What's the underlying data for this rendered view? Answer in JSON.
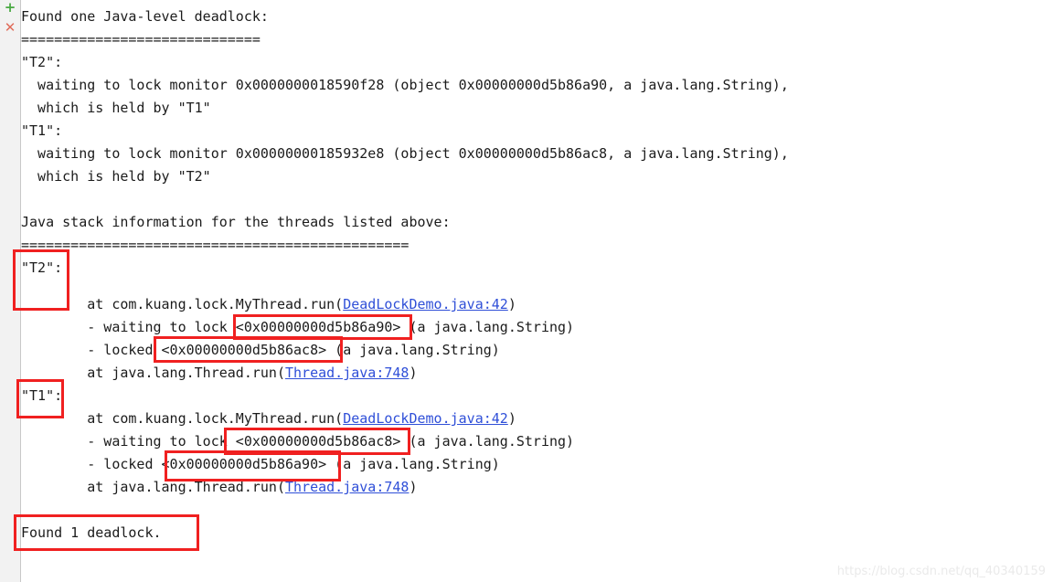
{
  "gutter": {
    "add_icon": "+",
    "close_icon": "✕"
  },
  "console": {
    "lines": [
      {
        "id": "l1",
        "text": "Found one Java-level deadlock:"
      },
      {
        "id": "l2",
        "text": "============================="
      },
      {
        "id": "l3",
        "text": "\"T2\":"
      },
      {
        "id": "l4",
        "text": "  waiting to lock monitor 0x0000000018590f28 (object 0x00000000d5b86a90, a java.lang.String),"
      },
      {
        "id": "l5",
        "text": "  which is held by \"T1\""
      },
      {
        "id": "l6",
        "text": "\"T1\":"
      },
      {
        "id": "l7",
        "text": "  waiting to lock monitor 0x00000000185932e8 (object 0x00000000d5b86ac8, a java.lang.String),"
      },
      {
        "id": "l8",
        "text": "  which is held by \"T2\""
      },
      {
        "id": "l9",
        "text": ""
      },
      {
        "id": "l10",
        "text": "Java stack information for the threads listed above:"
      },
      {
        "id": "l11",
        "text": "==============================================="
      },
      {
        "id": "l12",
        "text": "\"T2\":"
      }
    ],
    "t2_stack": {
      "at_mythread_prefix": "        at com.kuang.lock.MyThread.run(",
      "at_mythread_link": "DeadLockDemo.java:42",
      "at_mythread_suffix": ")",
      "waiting": "        - waiting to lock <0x00000000d5b86a90> (a java.lang.String)",
      "locked": "        - locked <0x00000000d5b86ac8> (a java.lang.String)",
      "at_thread_prefix": "        at java.lang.Thread.run(",
      "at_thread_link": "Thread.java:748",
      "at_thread_suffix": ")"
    },
    "t1_label": "\"T1\":",
    "t1_stack": {
      "at_mythread_prefix": "        at com.kuang.lock.MyThread.run(",
      "at_mythread_link": "DeadLockDemo.java:42",
      "at_mythread_suffix": ")",
      "waiting": "        - waiting to lock <0x00000000d5b86ac8> (a java.lang.String)",
      "locked": "        - locked <0x00000000d5b86a90> (a java.lang.String)",
      "at_thread_prefix": "        at java.lang.Thread.run(",
      "at_thread_link": "Thread.java:748",
      "at_thread_suffix": ")"
    },
    "found_deadlock": "Found 1 deadlock."
  },
  "annotations": {
    "highlight_color": "#f02020",
    "boxes": [
      {
        "name": "t2-thread-label-box",
        "label": "\"T2\":"
      },
      {
        "name": "t2-waiting-lock-box",
        "label": "<0x00000000d5b86a90>"
      },
      {
        "name": "t2-locked-lock-box",
        "label": "<0x00000000d5b86ac8>"
      },
      {
        "name": "t1-thread-label-box",
        "label": "\"T1\":"
      },
      {
        "name": "t1-waiting-lock-box",
        "label": "<0x00000000d5b86ac8>"
      },
      {
        "name": "t1-locked-lock-box",
        "label": "<0x00000000d5b86a90>"
      },
      {
        "name": "found-deadlock-box",
        "label": "Found 1 deadlock."
      }
    ]
  },
  "watermark": {
    "text": "https://blog.csdn.net/qq_40340159"
  }
}
